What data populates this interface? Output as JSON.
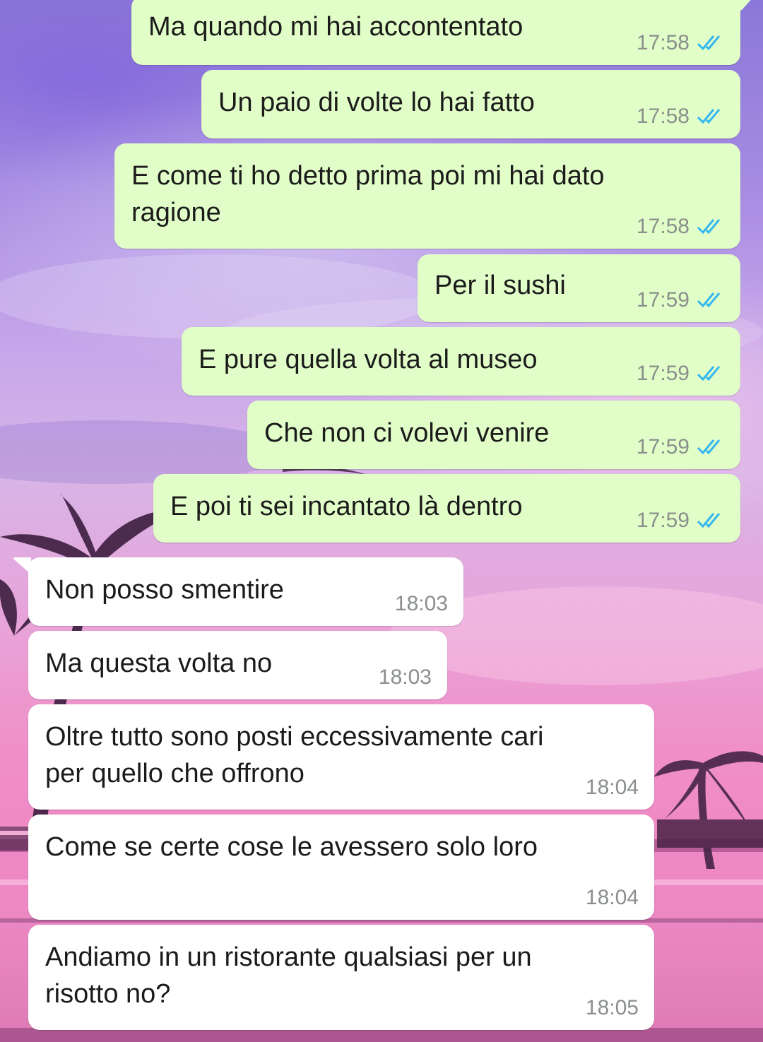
{
  "colors": {
    "outgoing_bubble": "#e2fec8",
    "incoming_bubble": "#ffffff",
    "timestamp": "#8a8f8c",
    "read_ticks": "#34b7f1"
  },
  "icons": {
    "read_receipt": "double-check-icon"
  },
  "messages": [
    {
      "direction": "outgoing",
      "text": "Ma quando mi hai accontentato",
      "time": "17:58",
      "read": true
    },
    {
      "direction": "outgoing",
      "text": "Un paio di volte lo hai fatto",
      "time": "17:58",
      "read": true
    },
    {
      "direction": "outgoing",
      "text": "E come ti ho detto prima poi mi hai dato\nragione",
      "time": "17:58",
      "read": true
    },
    {
      "direction": "outgoing",
      "text": "Per il sushi",
      "time": "17:59",
      "read": true
    },
    {
      "direction": "outgoing",
      "text": "E pure quella volta al museo",
      "time": "17:59",
      "read": true
    },
    {
      "direction": "outgoing",
      "text": "Che non ci volevi venire",
      "time": "17:59",
      "read": true
    },
    {
      "direction": "outgoing",
      "text": "E poi ti sei incantato là dentro",
      "time": "17:59",
      "read": true
    },
    {
      "direction": "incoming",
      "text": "Non posso smentire",
      "time": "18:03"
    },
    {
      "direction": "incoming",
      "text": "Ma questa volta no",
      "time": "18:03"
    },
    {
      "direction": "incoming",
      "text": "Oltre tutto sono posti eccessivamente cari\nper quello che offrono",
      "time": "18:04"
    },
    {
      "direction": "incoming",
      "text": "Come se certe cose le avessero solo loro",
      "time": "18:04"
    },
    {
      "direction": "incoming",
      "text": "Andiamo in un ristorante qualsiasi per un\nrisotto no?",
      "time": "18:05"
    }
  ]
}
